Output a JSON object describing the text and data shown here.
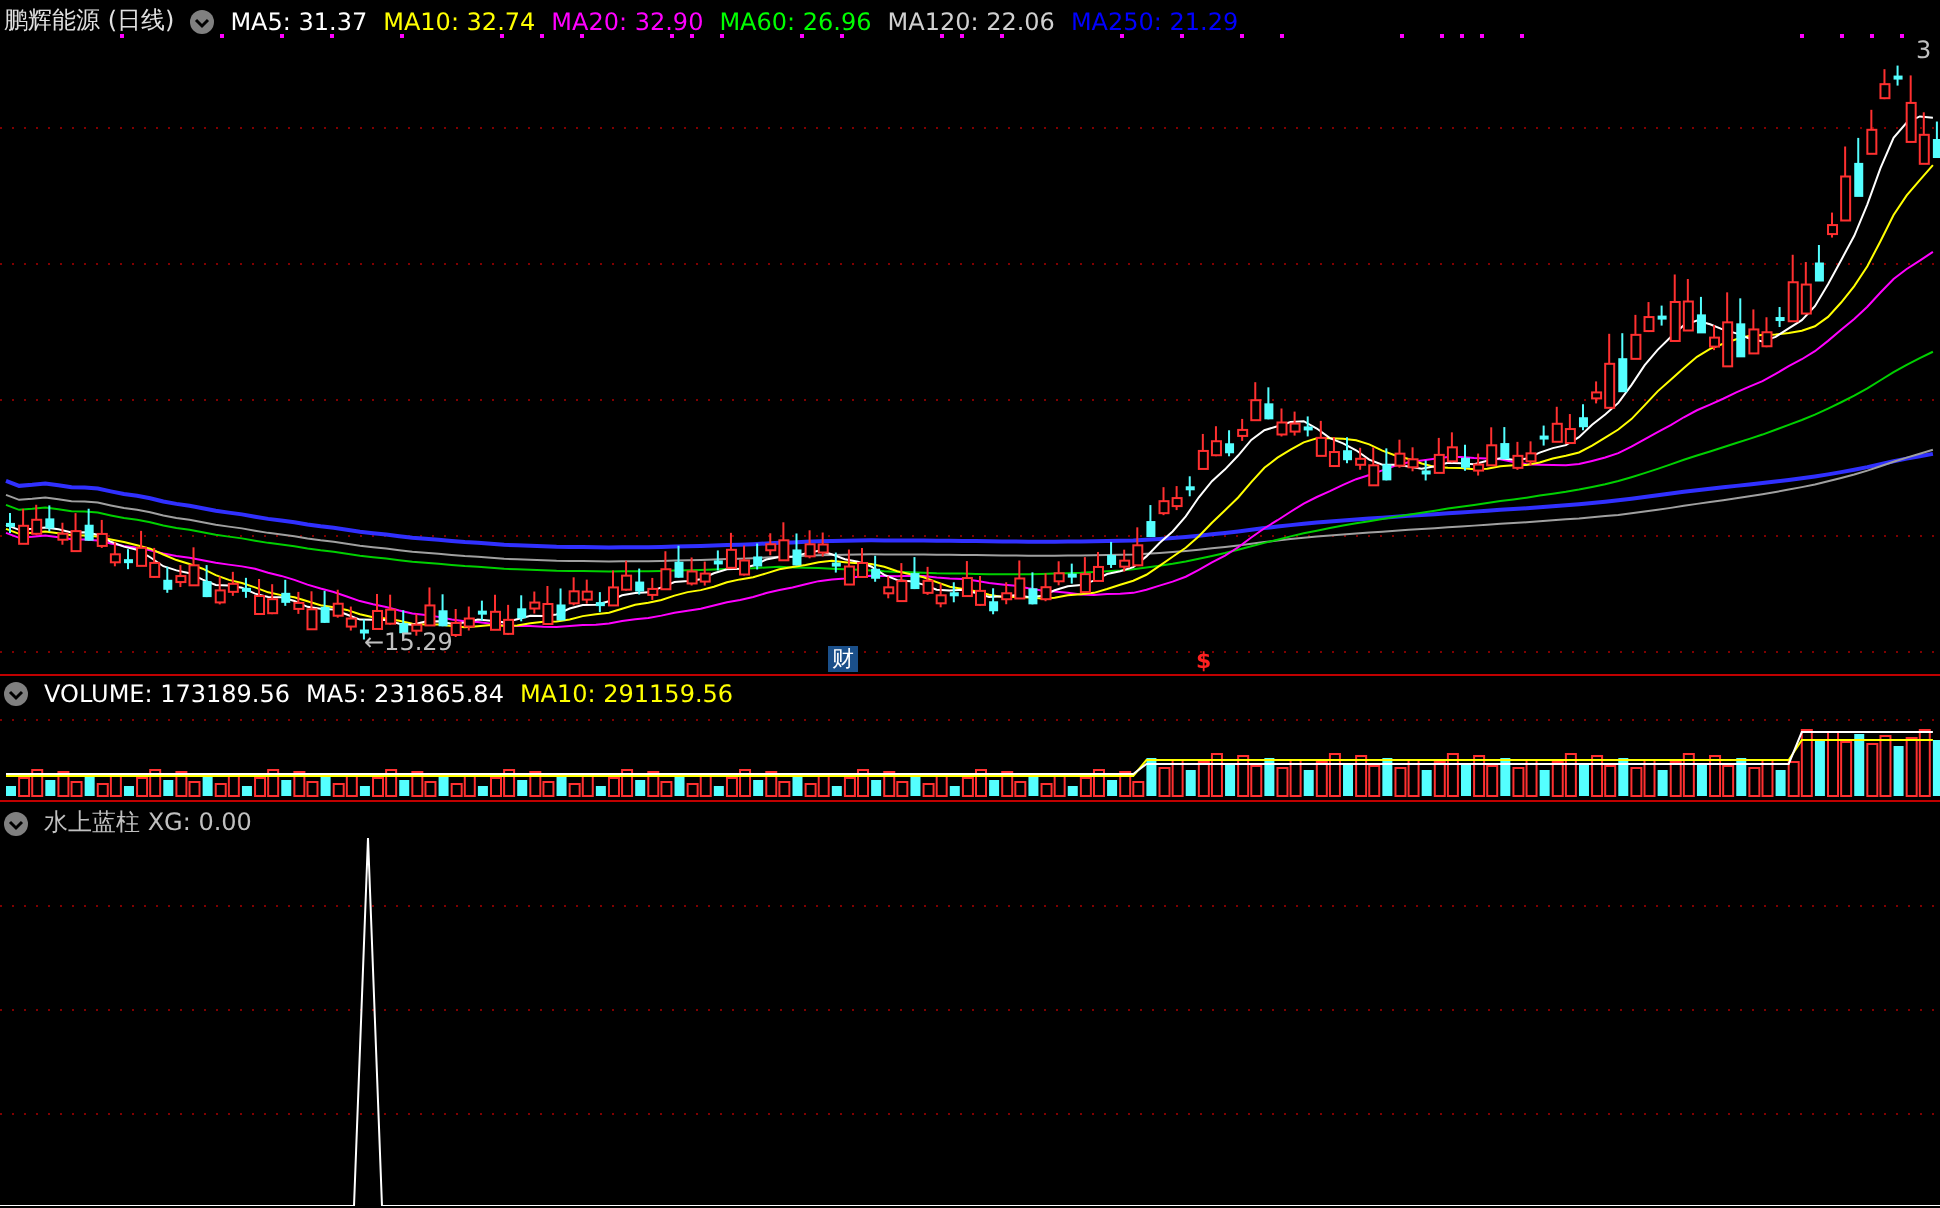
{
  "title": "鹏辉能源 (日线)",
  "main_indicators": [
    {
      "label": "MA5: 31.37",
      "color": "#ffffff"
    },
    {
      "label": "MA10: 32.74",
      "color": "#ffff00"
    },
    {
      "label": "MA20: 32.90",
      "color": "#ff00ff"
    },
    {
      "label": "MA60: 26.96",
      "color": "#00ff00"
    },
    {
      "label": "MA120: 22.06",
      "color": "#d0d0d0"
    },
    {
      "label": "MA250: 21.29",
      "color": "#0000ff"
    }
  ],
  "low_mark": "←15.29",
  "high_mark": "3",
  "event_marks": [
    {
      "text": "财",
      "kind": "finance"
    },
    {
      "text": "$",
      "kind": "dividend"
    }
  ],
  "volume_indicators": [
    {
      "label": "VOLUME: 173189.56",
      "color": "#ffffff"
    },
    {
      "label": "MA5: 231865.84",
      "color": "#ffffff"
    },
    {
      "label": "MA10: 291159.56",
      "color": "#ffff00"
    }
  ],
  "sub_indicators": [
    {
      "label": "水上蓝柱 XG: 0.00",
      "color": "#c0c0c0"
    }
  ]
}
